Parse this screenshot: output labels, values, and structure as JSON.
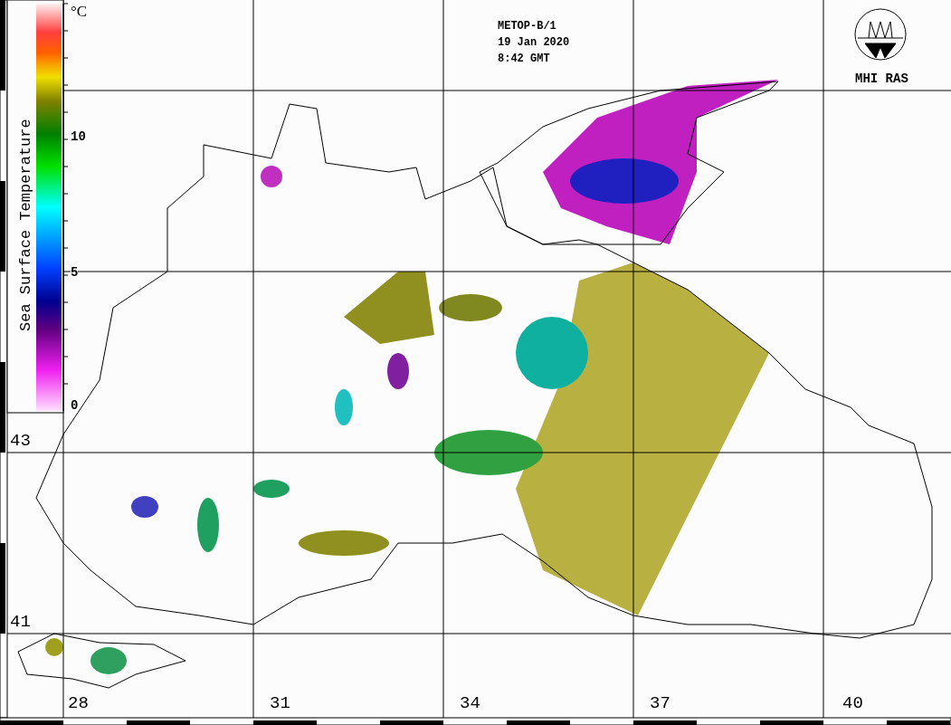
{
  "header": {
    "lines": [
      "METOP-B/1",
      "19 Jan 2020",
      "8:42 GMT"
    ]
  },
  "logo": {
    "text": "MHI RAS"
  },
  "legend": {
    "title": "Sea Surface Temperature",
    "unit": "°C",
    "ticks": [
      "10",
      "5",
      "0"
    ]
  },
  "latitude_labels": [
    "43",
    "41"
  ],
  "longitude_labels": [
    "28",
    "31",
    "34",
    "37",
    "40"
  ]
}
